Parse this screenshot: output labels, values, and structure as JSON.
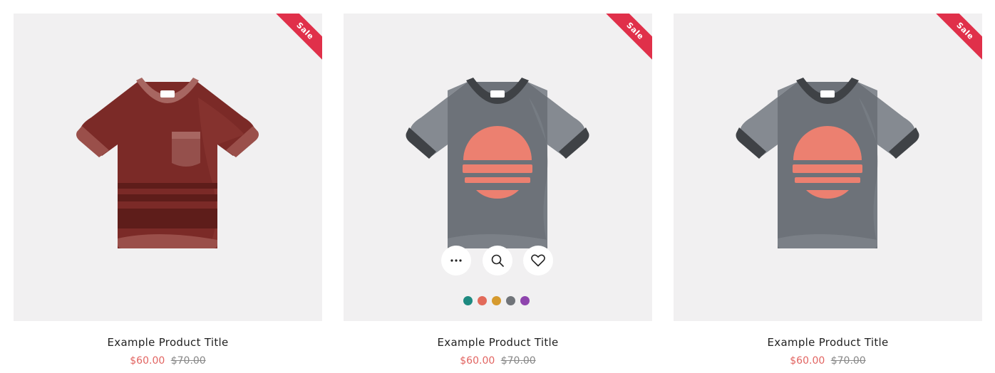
{
  "products": [
    {
      "badge": "Sale",
      "title": "Example Product Title",
      "sale_price": "$60.00",
      "regular_price": "$70.00",
      "shirt_variant": "maroon-pocket-stripes",
      "shirt_color": "#7b2a27"
    },
    {
      "badge": "Sale",
      "title": "Example Product Title",
      "sale_price": "$60.00",
      "regular_price": "$70.00",
      "shirt_variant": "gray-sunset",
      "shirt_color": "#6d7279",
      "actions": [
        {
          "icon": "more-options-icon"
        },
        {
          "icon": "search-icon"
        },
        {
          "icon": "heart-icon"
        }
      ],
      "swatches": [
        "#1e8a80",
        "#e26a5a",
        "#d69a2e",
        "#707479",
        "#8e44ad"
      ]
    },
    {
      "badge": "Sale",
      "title": "Example Product Title",
      "sale_price": "$60.00",
      "regular_price": "$70.00",
      "shirt_variant": "gray-sunset",
      "shirt_color": "#6d7279"
    }
  ],
  "colors": {
    "badge": "#e0304a",
    "sale_price": "#e26461",
    "card_background": "#f1f0f1"
  }
}
